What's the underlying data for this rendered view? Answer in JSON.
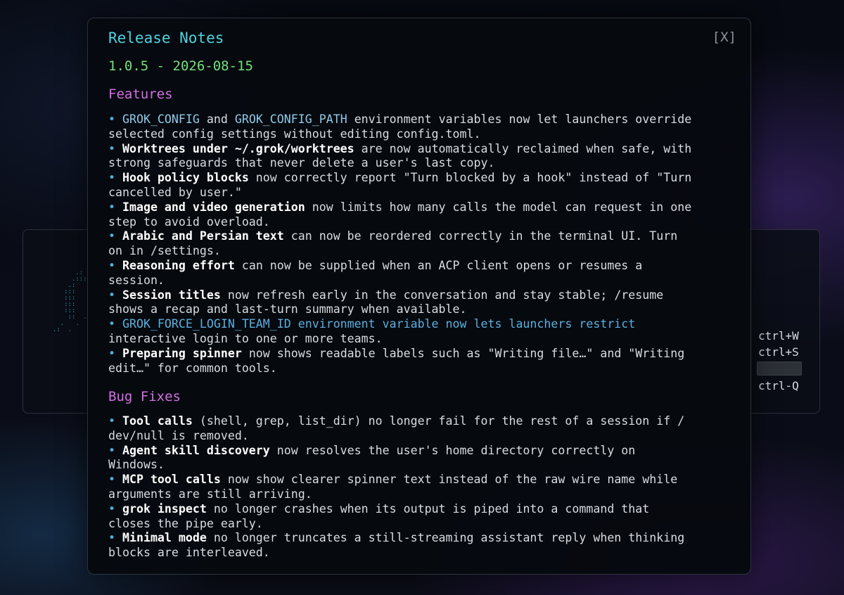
{
  "background": {
    "shortcuts": [
      "ctrl+W",
      "ctrl+S",
      "ctrl-Q"
    ]
  },
  "dialog": {
    "title": "Release Notes",
    "close_label": "[X]",
    "version": "1.0.5 - 2026-08-15",
    "sections": [
      {
        "heading": "Features",
        "items": [
          [
            "GROK_CONFIG",
            " and ",
            "GROK_CONFIG_PATH",
            " environment variables now let launchers override",
            "selected config settings without editing config.toml."
          ],
          [
            "Worktrees under ~/.grok/worktrees",
            " are now automatically reclaimed when safe, with",
            "strong safeguards that never delete a user's last copy."
          ],
          [
            "Hook policy blocks",
            " now correctly report \"Turn blocked by a hook\" instead of \"Turn",
            "cancelled by user.\""
          ],
          [
            "Image and video generation",
            " now limits how many calls the model can request in one",
            "step to avoid overload."
          ],
          [
            "Arabic and Persian text",
            " can now be reordered correctly in the terminal UI. Turn",
            "on in /settings."
          ],
          [
            "Reasoning effort",
            " can now be supplied when an ACP client opens or resumes a",
            "session."
          ],
          [
            "Session titles",
            " now refresh early in the conversation and stay stable; /resume",
            "shows a recap and last-turn summary when available."
          ],
          [
            "GROK_FORCE_LOGIN_TEAM_ID environment variable now lets launchers restrict",
            "interactive login to one or more teams."
          ],
          [
            "Preparing spinner",
            " now shows readable labels such as \"Writing file…\" and \"Writing",
            "edit…\" for common tools."
          ]
        ]
      },
      {
        "heading": "Bug Fixes",
        "items": [
          [
            "Tool calls",
            " (shell, grep, list_dir) no longer fail for the rest of a session if /",
            "dev/null is removed."
          ],
          [
            "Agent skill discovery",
            " now resolves the user's home directory correctly on",
            "Windows."
          ],
          [
            "MCP tool calls",
            " now show clearer spinner text instead of the raw wire name while",
            "arguments are still arriving."
          ],
          [
            "grok inspect",
            " no longer crashes when its output is piped into a command that",
            "closes the pipe early."
          ],
          [
            "Minimal mode",
            " no longer truncates a still-streaming assistant reply when thinking",
            "blocks are interleaved."
          ]
        ]
      }
    ]
  }
}
